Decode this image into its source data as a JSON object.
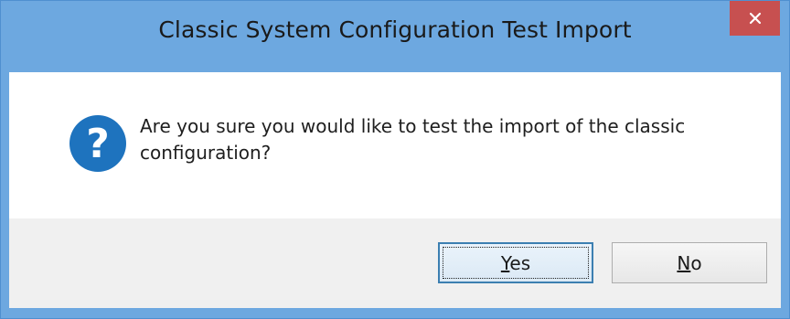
{
  "window": {
    "title": "Classic System Configuration Test Import"
  },
  "dialog": {
    "icon": "question-icon",
    "message": "Are you sure you would like to test the import of the classic configuration?"
  },
  "buttons": {
    "yes": {
      "mnemonic": "Y",
      "rest": "es"
    },
    "no": {
      "mnemonic": "N",
      "rest": "o"
    }
  },
  "colors": {
    "frame": "#6da8e0",
    "close_button": "#c75050",
    "icon": "#1e73be"
  }
}
